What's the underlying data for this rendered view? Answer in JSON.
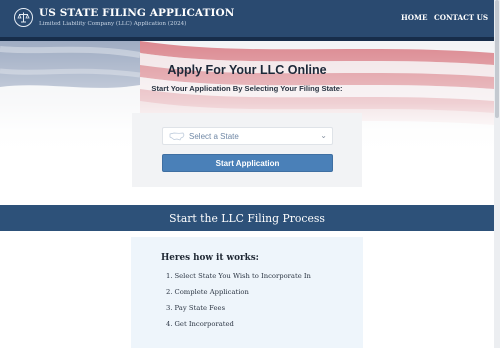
{
  "header": {
    "title": "US STATE FILING APPLICATION",
    "subtitle": "Limited Liability Company (LLC) Application (2024)",
    "logo_icon": "scales-of-justice-icon",
    "nav": {
      "home": "HOME",
      "contact": "CONTACT US"
    }
  },
  "hero": {
    "title": "Apply For Your LLC Online",
    "subtitle": "Start Your Application By Selecting Your Filing State:"
  },
  "form": {
    "state_select": {
      "placeholder": "Select a State",
      "icon": "us-map-icon"
    },
    "submit_label": "Start Application"
  },
  "process": {
    "heading": "Start the LLC Filing Process",
    "how_title": "Heres how it works:",
    "steps": [
      {
        "num": "1.",
        "text": "Select State You Wish to Incorporate In"
      },
      {
        "num": "2.",
        "text": "Complete Application"
      },
      {
        "num": "3.",
        "text": "Pay State Fees"
      },
      {
        "num": "4.",
        "text": "Get Incorporated"
      }
    ]
  },
  "colors": {
    "header_bg": "#2a4a70",
    "nav_underline": "#172d4a",
    "accent_button": "#4a80b8",
    "section_band": "#2d5179",
    "info_card_bg": "#eef5fb"
  }
}
